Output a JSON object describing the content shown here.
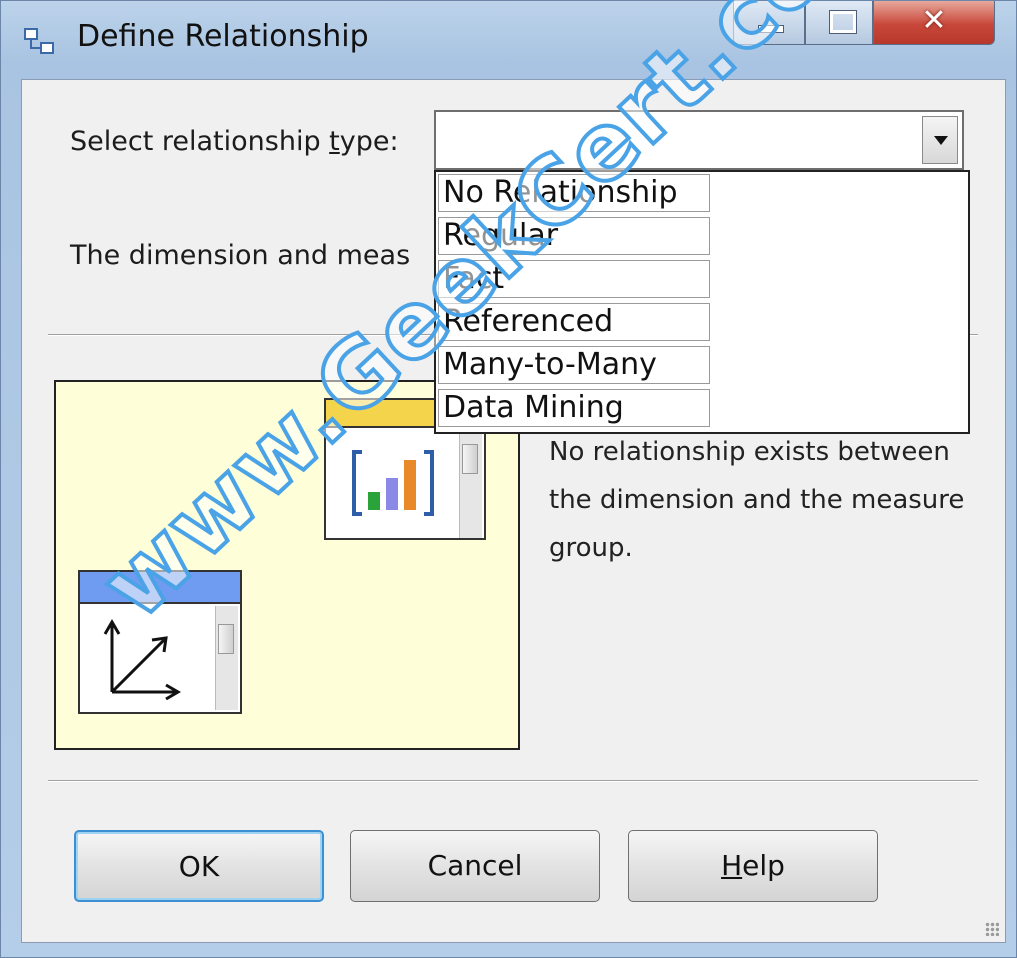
{
  "window": {
    "title": "Define Relationship",
    "icon": "relationship-icon"
  },
  "form": {
    "relationship_type_label": "Select relationship type:",
    "relationship_type_value": "",
    "description_truncated": "The dimension and meas"
  },
  "dropdown": {
    "options": [
      "No Relationship",
      "Regular",
      "Fact",
      "Referenced",
      "Many-to-Many",
      "Data Mining"
    ]
  },
  "diagram": {
    "measure_group_icon": "bar-chart-icon",
    "dimension_icon": "axis-arrows-icon",
    "description": "No relationship exists between the dimension and the measure group."
  },
  "buttons": {
    "ok": "OK",
    "cancel": "Cancel",
    "help": "Help"
  },
  "watermark": "www.GeekCert.com",
  "colors": {
    "measure_header": "#f3d44a",
    "dimension_header": "#6f9bf0",
    "diagram_bg": "#fefed8",
    "close_button": "#c8473a"
  }
}
